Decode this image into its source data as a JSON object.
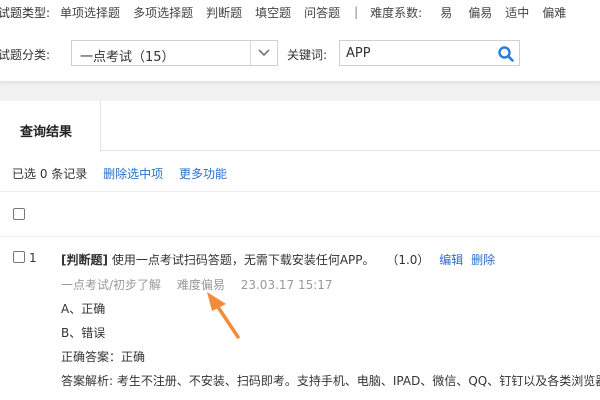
{
  "filters": {
    "type_label": "试题类型:",
    "type_options": [
      "单项选择题",
      "多项选择题",
      "判断题",
      "填空题",
      "问答题"
    ],
    "separator": "|",
    "difficulty_label": "难度系数:",
    "difficulty_options": [
      "易",
      "偏易",
      "适中",
      "偏难"
    ],
    "category_label": "试题分类:",
    "category_value": "一点考试（15）",
    "keyword_label": "关键词:",
    "keyword_value": "APP"
  },
  "results": {
    "tab_label": "查询结果",
    "selected_text": "已选 0 条记录",
    "delete_selected": "删除选中项",
    "more": "更多功能"
  },
  "question": {
    "number": "1",
    "type": "[判断题]",
    "text": "使用一点考试扫码答题，无需下载安装任何APP。",
    "score": "（1.0）",
    "edit": "编辑",
    "delete": "删除",
    "category_path": "一点考试/初步了解",
    "difficulty": "难度偏易",
    "date": "23.03.17 15:17",
    "options": [
      "A、正确",
      "B、错误"
    ],
    "answer": "正确答案：正确",
    "analysis": "答案解析: 考生不注册、不安装、扫码即考。支持手机、电脑、IPAD、微信、QQ、钉钉以及各类浏览器"
  },
  "colors": {
    "link": "#2a6fc9",
    "annotation_arrow": "#f08c3a",
    "search_icon": "#2b7de0"
  }
}
